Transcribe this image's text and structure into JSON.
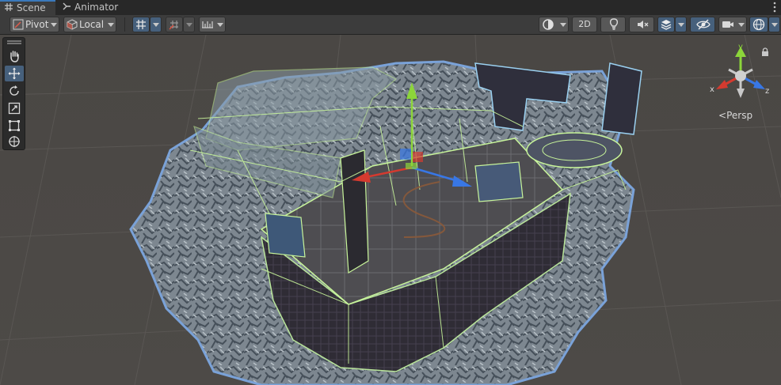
{
  "tabs": [
    {
      "label": "Scene",
      "icon": "grid-icon",
      "active": true
    },
    {
      "label": "Animator",
      "icon": "animator-icon",
      "active": false
    }
  ],
  "toolbar": {
    "pivot_label": "Pivot",
    "local_label": "Local",
    "mode_2d_label": "2D"
  },
  "gizmo": {
    "x_label": "x",
    "y_label": "y",
    "z_label": "z",
    "projection_label": "Persp"
  },
  "tool_panel": {
    "items": [
      "view-tool",
      "move-tool",
      "rotate-tool",
      "scale-tool",
      "rect-tool",
      "transform-tool"
    ],
    "active": "move-tool"
  },
  "colors": {
    "tab_bar": "#282828",
    "toolbar": "#3c3c3c",
    "active_toggle": "#46607c",
    "selection_outline": "#6c9ad8",
    "wireframe": "#c8f59a",
    "axis_x": "#d43a2f",
    "axis_y": "#8cd53a",
    "axis_z": "#3877e5"
  }
}
